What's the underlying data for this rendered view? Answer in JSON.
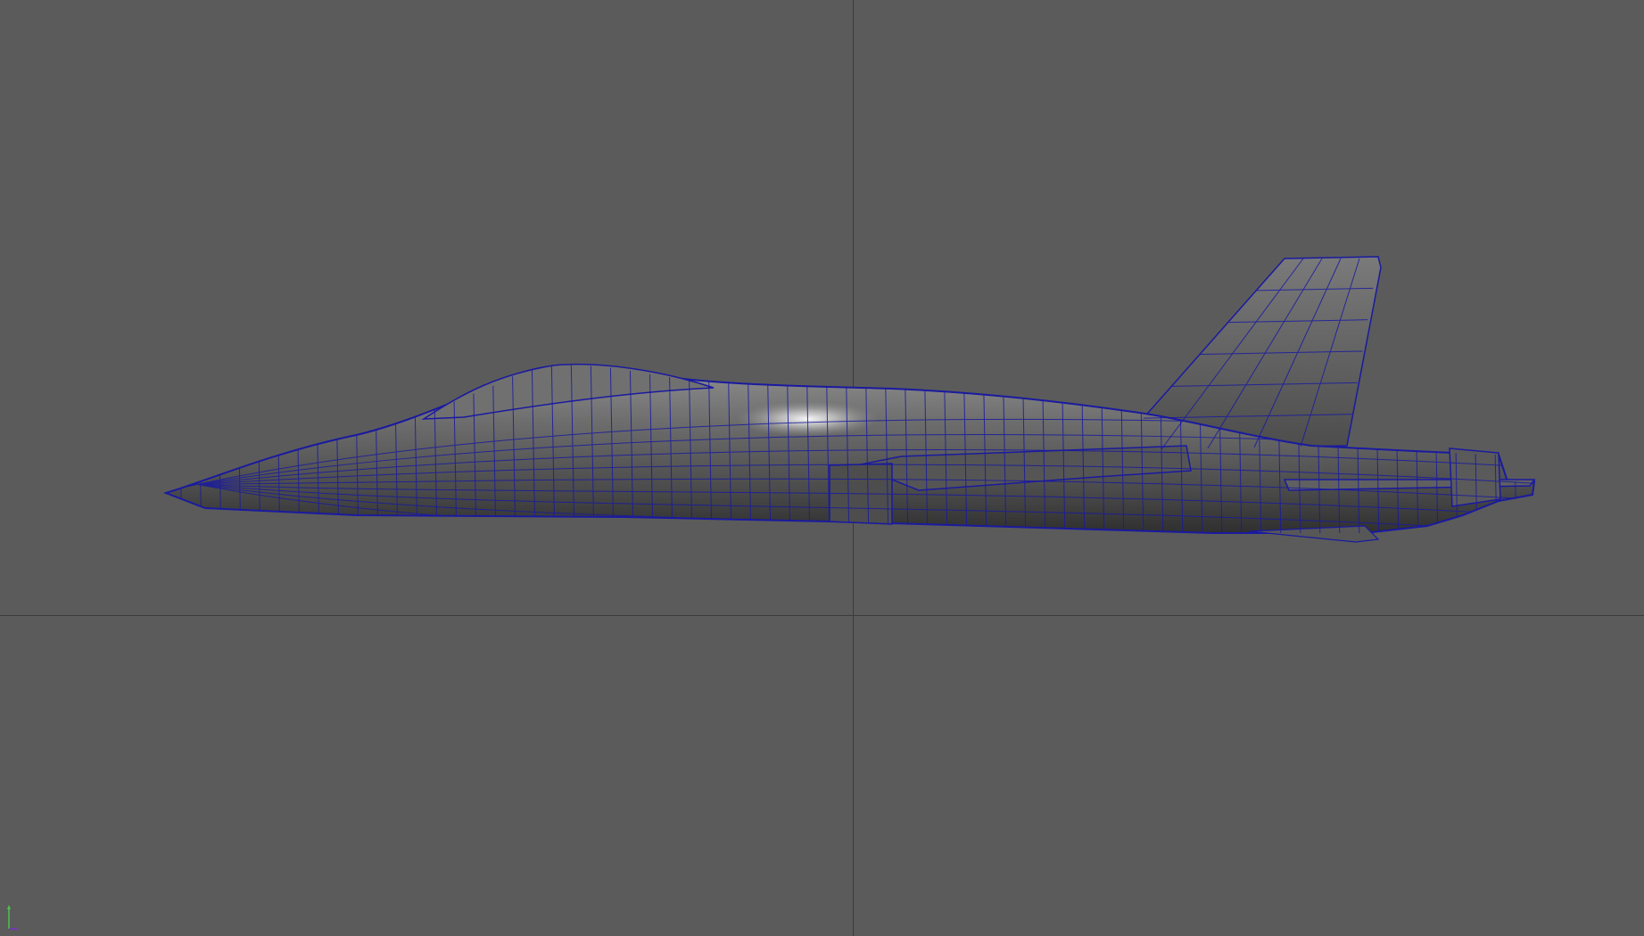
{
  "viewport": {
    "background": "#5b5b5b",
    "grid_color": "#3c3c3c",
    "wireframe_color": "#1a1aa0",
    "camera_label": "",
    "view_axis": {
      "y_color": "#4ec24e",
      "x_color": "#7a2fd0"
    }
  },
  "scene": {
    "object": "jet-fighter-mesh",
    "display_mode": "wireframe-on-shaded"
  }
}
